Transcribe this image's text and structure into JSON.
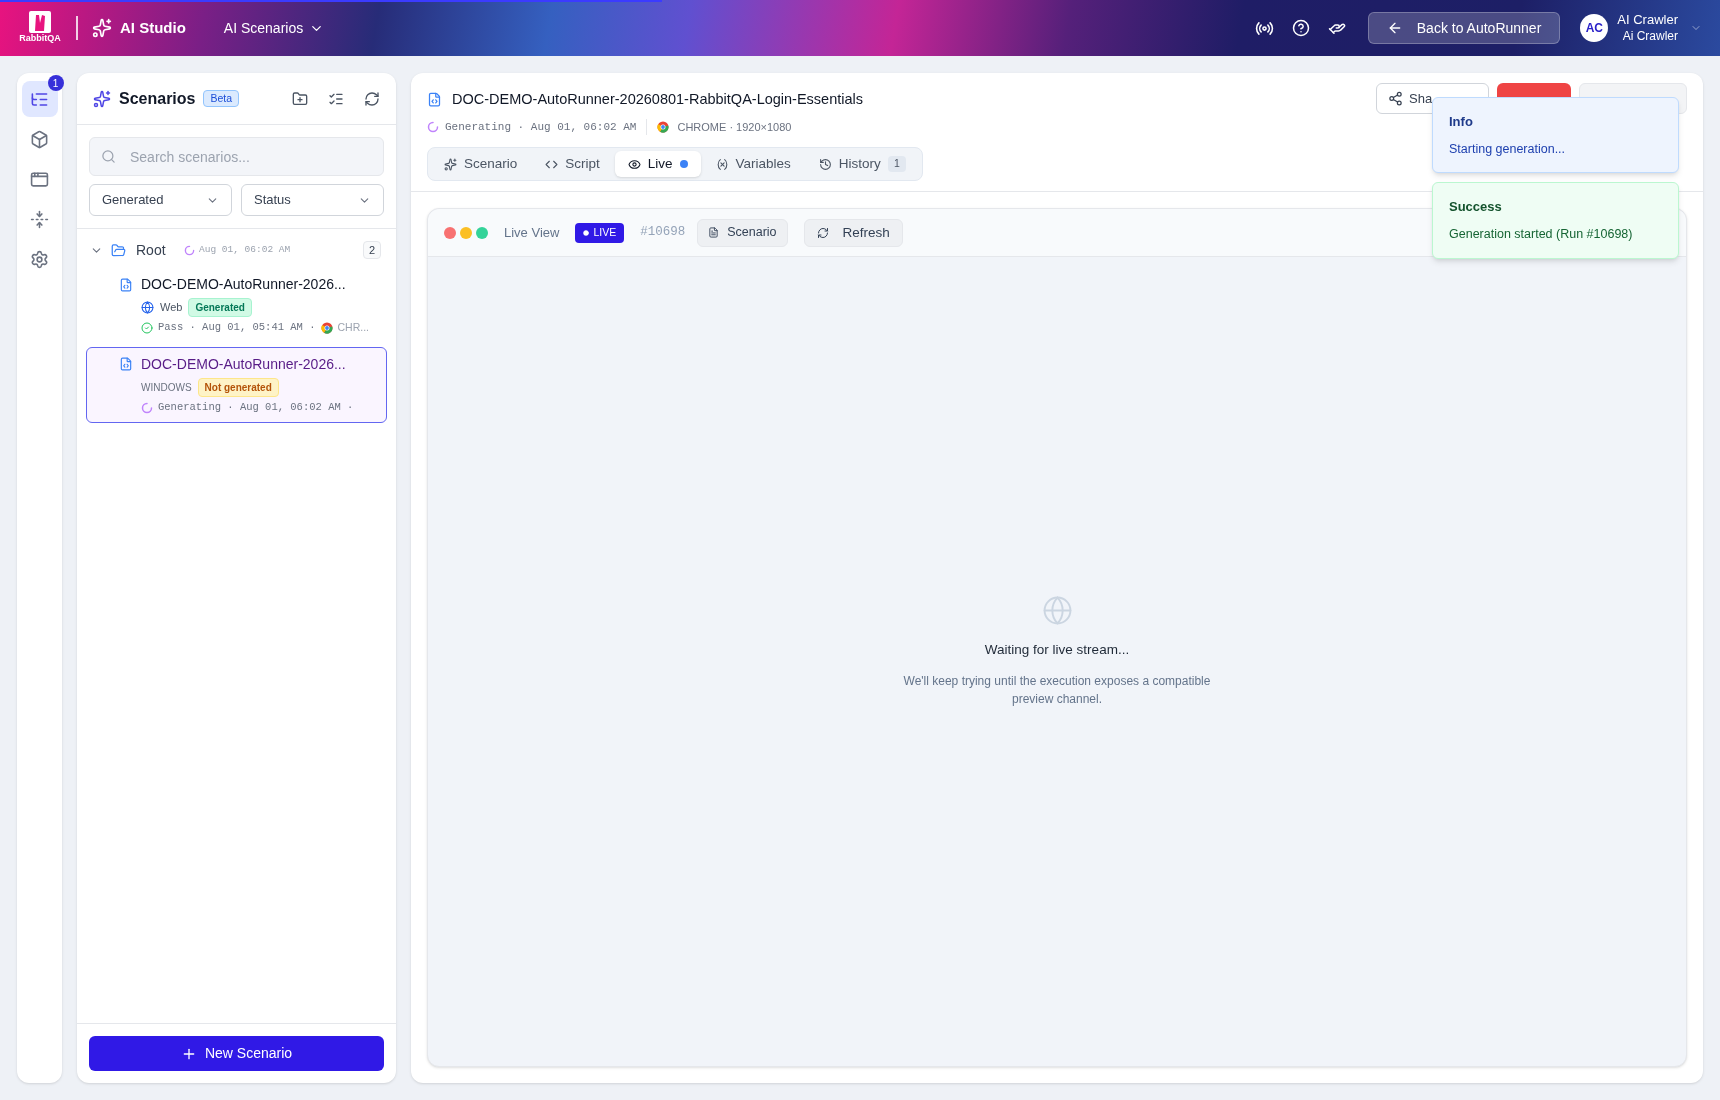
{
  "header": {
    "logo_text": "RabbitQA",
    "app_title": "AI Studio",
    "nav_menu": "AI Scenarios",
    "back_button": "Back to AutoRunner",
    "user": {
      "initials": "AC",
      "name": "AI Crawler",
      "subtitle": "Ai Crawler"
    },
    "progress": {
      "level": 0.385
    }
  },
  "rail": [
    {
      "kind": "tree",
      "selected": true,
      "badge": "1"
    },
    {
      "kind": "cube",
      "selected": false
    },
    {
      "kind": "browser",
      "selected": false
    },
    {
      "kind": "split",
      "selected": false
    },
    {
      "kind": "settings",
      "selected": false
    }
  ],
  "scenarios_panel": {
    "title": "Scenarios",
    "badge": "Beta",
    "search": {
      "placeholder": "Search scenarios..."
    },
    "filters": [
      "Generated",
      "Status"
    ],
    "tree": {
      "name": "Root",
      "expanded": true,
      "time": "Aug 01, 06:02 AM",
      "count": "2",
      "children": [
        {
          "name": "DOC-DEMO-AutoRunner-2026...",
          "platform": {
            "kind": "web",
            "label": "Web"
          },
          "tag": {
            "kind": "generated",
            "label": "Generated"
          },
          "status": {
            "kind": "pass",
            "text": "Pass · Aug 01, 05:41 AM ·"
          },
          "browser": "CHR...",
          "selected": false
        },
        {
          "name": "DOC-DEMO-AutoRunner-2026...",
          "platform": {
            "kind": "windows",
            "label": "WINDOWS"
          },
          "tag": {
            "kind": "not_generated",
            "label": "Not generated"
          },
          "status": {
            "kind": "generating",
            "text": "Generating · Aug 01, 06:02 AM ·"
          },
          "selected": true
        }
      ]
    },
    "new_button": "New Scenario"
  },
  "main": {
    "title": "DOC-DEMO-AutoRunner-20260801-RabbitQA-Login-Essentials",
    "status": "Generating · Aug 01, 06:02 AM",
    "browser": "CHROME · 1920×1080",
    "actions": [
      {
        "kind": "share",
        "label": "Sha"
      },
      {
        "kind": "stop"
      },
      {
        "kind": "running"
      }
    ],
    "tabs": [
      {
        "kind": "scenario",
        "label": "Scenario",
        "selected": false,
        "indicator": false
      },
      {
        "kind": "script",
        "label": "Script",
        "selected": false,
        "indicator": false
      },
      {
        "kind": "live",
        "label": "Live",
        "selected": true,
        "indicator": true
      },
      {
        "kind": "variables",
        "label": "Variables",
        "selected": false,
        "indicator": false
      },
      {
        "kind": "history",
        "label": "History",
        "selected": false,
        "indicator": false,
        "count": "1"
      }
    ],
    "live": {
      "title": "Live View",
      "badge": "LIVE",
      "run": "#10698",
      "buttons": [
        {
          "kind": "scenario",
          "label": "Scenario"
        },
        {
          "kind": "refresh",
          "label": "Refresh"
        }
      ],
      "empty": {
        "title": "Waiting for live stream...",
        "text": "We'll keep trying until the execution exposes a compatible preview channel."
      }
    }
  },
  "toasts": [
    {
      "kind": "info",
      "title": "Info",
      "message": "Starting generation..."
    },
    {
      "kind": "success",
      "title": "Success",
      "message": "Generation started (Run #10698)"
    }
  ]
}
